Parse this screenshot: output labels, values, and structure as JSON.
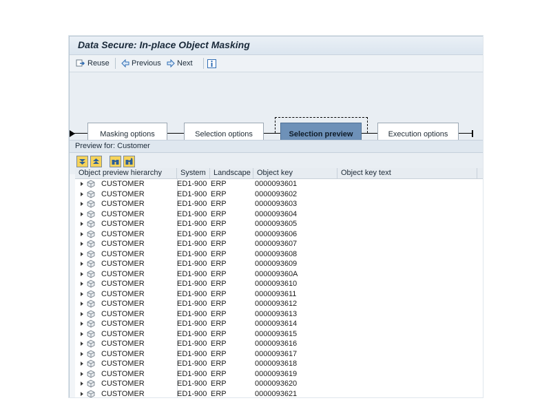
{
  "window": {
    "title": "Data Secure: In-place Object Masking"
  },
  "toolbar": {
    "reuse_label": "Reuse",
    "previous_label": "Previous",
    "next_label": "Next"
  },
  "roadmap": {
    "steps": [
      {
        "label": "Masking options",
        "active": false
      },
      {
        "label": "Selection options",
        "active": false
      },
      {
        "label": "Selection preview",
        "active": true
      },
      {
        "label": "Execution options",
        "active": false
      }
    ]
  },
  "preview": {
    "header": "Preview for: Customer",
    "columns": [
      "Object preview hierarchy",
      "System",
      "Landscape",
      "Object key",
      "Object key text"
    ],
    "rows": [
      {
        "object": "CUSTOMER",
        "system": "ED1-900",
        "landscape": "ERP",
        "key": "0000093601",
        "key_text": ""
      },
      {
        "object": "CUSTOMER",
        "system": "ED1-900",
        "landscape": "ERP",
        "key": "0000093602",
        "key_text": ""
      },
      {
        "object": "CUSTOMER",
        "system": "ED1-900",
        "landscape": "ERP",
        "key": "0000093603",
        "key_text": ""
      },
      {
        "object": "CUSTOMER",
        "system": "ED1-900",
        "landscape": "ERP",
        "key": "0000093604",
        "key_text": ""
      },
      {
        "object": "CUSTOMER",
        "system": "ED1-900",
        "landscape": "ERP",
        "key": "0000093605",
        "key_text": ""
      },
      {
        "object": "CUSTOMER",
        "system": "ED1-900",
        "landscape": "ERP",
        "key": "0000093606",
        "key_text": ""
      },
      {
        "object": "CUSTOMER",
        "system": "ED1-900",
        "landscape": "ERP",
        "key": "0000093607",
        "key_text": ""
      },
      {
        "object": "CUSTOMER",
        "system": "ED1-900",
        "landscape": "ERP",
        "key": "0000093608",
        "key_text": ""
      },
      {
        "object": "CUSTOMER",
        "system": "ED1-900",
        "landscape": "ERP",
        "key": "0000093609",
        "key_text": ""
      },
      {
        "object": "CUSTOMER",
        "system": "ED1-900",
        "landscape": "ERP",
        "key": "000009360A",
        "key_text": ""
      },
      {
        "object": "CUSTOMER",
        "system": "ED1-900",
        "landscape": "ERP",
        "key": "0000093610",
        "key_text": ""
      },
      {
        "object": "CUSTOMER",
        "system": "ED1-900",
        "landscape": "ERP",
        "key": "0000093611",
        "key_text": ""
      },
      {
        "object": "CUSTOMER",
        "system": "ED1-900",
        "landscape": "ERP",
        "key": "0000093612",
        "key_text": ""
      },
      {
        "object": "CUSTOMER",
        "system": "ED1-900",
        "landscape": "ERP",
        "key": "0000093613",
        "key_text": ""
      },
      {
        "object": "CUSTOMER",
        "system": "ED1-900",
        "landscape": "ERP",
        "key": "0000093614",
        "key_text": ""
      },
      {
        "object": "CUSTOMER",
        "system": "ED1-900",
        "landscape": "ERP",
        "key": "0000093615",
        "key_text": ""
      },
      {
        "object": "CUSTOMER",
        "system": "ED1-900",
        "landscape": "ERP",
        "key": "0000093616",
        "key_text": ""
      },
      {
        "object": "CUSTOMER",
        "system": "ED1-900",
        "landscape": "ERP",
        "key": "0000093617",
        "key_text": ""
      },
      {
        "object": "CUSTOMER",
        "system": "ED1-900",
        "landscape": "ERP",
        "key": "0000093618",
        "key_text": ""
      },
      {
        "object": "CUSTOMER",
        "system": "ED1-900",
        "landscape": "ERP",
        "key": "0000093619",
        "key_text": ""
      },
      {
        "object": "CUSTOMER",
        "system": "ED1-900",
        "landscape": "ERP",
        "key": "0000093620",
        "key_text": ""
      },
      {
        "object": "CUSTOMER",
        "system": "ED1-900",
        "landscape": "ERP",
        "key": "0000093621",
        "key_text": ""
      }
    ]
  },
  "icons": {
    "reuse": "reuse-icon",
    "previous": "arrow-left-icon",
    "next": "arrow-right-icon",
    "info": "info-icon",
    "expand_all": "expand-all-icon",
    "collapse_all": "collapse-all-icon",
    "find": "find-icon",
    "find_next": "find-next-icon",
    "object": "cube-icon",
    "expander": "triangle-right-icon"
  },
  "colors": {
    "active_step": "#6e91b8",
    "toolbar_button": "#f6d35a",
    "title_bar": "#dbe5ef"
  }
}
